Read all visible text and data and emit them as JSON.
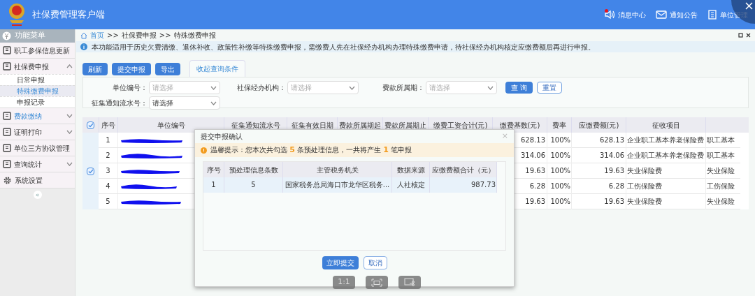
{
  "app": {
    "title": "社保费管理客户端",
    "header_links": [
      {
        "label": "消息中心",
        "kind": "message",
        "has_alert": true
      },
      {
        "label": "通知公告",
        "kind": "notice",
        "has_alert": false
      },
      {
        "label": "单位管理",
        "kind": "unit",
        "has_alert": false
      }
    ]
  },
  "sidebar": {
    "title": "功能菜单",
    "items": [
      {
        "label": "职工参保信息更新",
        "expandable": false,
        "selected": false
      },
      {
        "label": "社保费申报",
        "expandable": true,
        "expanded": true,
        "selected": false,
        "children": [
          {
            "label": "日常申报",
            "selected": false
          },
          {
            "label": "特殊缴费申报",
            "selected": true
          },
          {
            "label": "申报记录",
            "selected": false
          }
        ]
      },
      {
        "label": "费款缴纳",
        "expandable": true,
        "expanded": false,
        "selected": true
      },
      {
        "label": "证明打印",
        "expandable": true,
        "expanded": false,
        "selected": false
      },
      {
        "label": "单位三方协议管理",
        "expandable": false,
        "selected": false
      },
      {
        "label": "查询统计",
        "expandable": true,
        "expanded": false,
        "selected": false
      },
      {
        "label": "系统设置",
        "expandable": false,
        "selected": false,
        "kind": "settings"
      }
    ],
    "collapse": "«"
  },
  "breadcrumb": [
    "首页",
    ">>",
    "社保费申报",
    ">>",
    "特殊缴费申报"
  ],
  "info": "本功能适用于历史欠费清缴、退休补收、政策性补缴等特殊缴费申报，需缴费人先在社保经办机构办理特殊缴费申请，待社保经办机构核定应缴费额后再进行申报。",
  "toolbar": {
    "buttons": [
      "刷新",
      "提交申报",
      "导出"
    ],
    "tab": {
      "label": "收起查询条件",
      "selected": true
    }
  },
  "filters": [
    {
      "label": "单位编号：",
      "placeholder": "请选择"
    },
    {
      "label": "社保经办机构：",
      "placeholder": "请选择"
    },
    {
      "label": "费款所属期：",
      "placeholder": "请选择"
    },
    {
      "label": "征集通知流水号：",
      "value": "请选择"
    }
  ],
  "filter_buttons": {
    "query": "查 询",
    "reset": "重置"
  },
  "table": {
    "header_checked": true,
    "group_checked": true,
    "columns": [
      "序号",
      "单位编号",
      "征集通知流水号",
      "征集有效日期",
      "费款所属期起",
      "费款所属期止",
      "缴费工资合计(元)",
      "缴费基数(元)",
      "费率",
      "应缴费额(元)",
      "征收项目"
    ],
    "rows": [
      {
        "no": "1",
        "base": "628.13",
        "rate": "100%",
        "due": "628.13",
        "item": "企业职工基本养老保险费",
        "column_10": "职工基本"
      },
      {
        "no": "2",
        "base": "314.06",
        "rate": "100%",
        "due": "314.06",
        "item": "企业职工基本养老保险费",
        "column_10": "职工基本"
      },
      {
        "no": "3",
        "base": "19.63",
        "rate": "100%",
        "due": "19.63",
        "item": "失业保险费",
        "column_10": "失业保险"
      },
      {
        "no": "4",
        "base": "6.28",
        "rate": "100%",
        "due": "6.28",
        "item": "工伤保险费",
        "column_10": "工伤保险"
      },
      {
        "no": "5",
        "base": "19.63",
        "rate": "100%",
        "due": "19.63",
        "item": "失业保险费",
        "column_10": "失业保险"
      }
    ]
  },
  "dialog": {
    "title": "提交申报确认",
    "close": "×",
    "notice": [
      {
        "text": "温馨提示：您本次共勾选 "
      },
      {
        "text": "5",
        "kind": "count"
      },
      {
        "text": " 条预处理信息，一共将产生 "
      },
      {
        "text": "1",
        "kind": "count"
      },
      {
        "text": " 笔申报"
      }
    ],
    "columns": [
      "序号",
      "预处理信息条数",
      "主管税务机关",
      "数据来源",
      "应缴费额合计（元）"
    ],
    "rows": [
      [
        "1",
        "5",
        "国家税务总局海口市龙华区税务...",
        "人社核定",
        "987.73"
      ]
    ],
    "buttons": [
      {
        "label": "立即提交",
        "kind": "primary"
      },
      {
        "label": "取消",
        "kind": "secondary"
      }
    ]
  },
  "viewer_toolbar": {
    "ratio": "1:1"
  }
}
